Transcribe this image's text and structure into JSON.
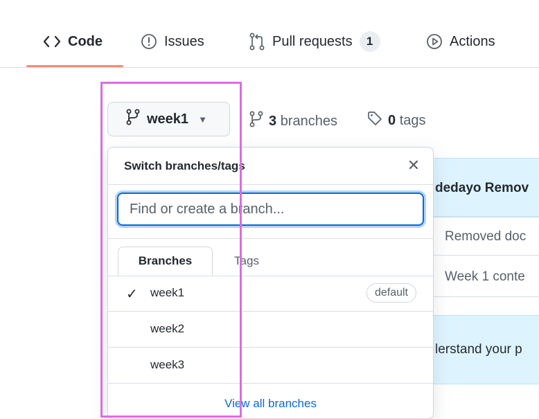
{
  "nav": {
    "tabs": [
      {
        "label": "Code",
        "icon": "code-icon",
        "active": true
      },
      {
        "label": "Issues",
        "icon": "issue-opened-icon"
      },
      {
        "label": "Pull requests",
        "icon": "git-pull-request-icon",
        "count": "1"
      },
      {
        "label": "Actions",
        "icon": "play-icon"
      }
    ]
  },
  "branch_selector": {
    "current": "week1",
    "branches_count": "3",
    "branches_label": "branches",
    "tags_count": "0",
    "tags_label": "tags"
  },
  "dropdown": {
    "title": "Switch branches/tags",
    "filter_placeholder": "Find or create a branch...",
    "tabs": [
      "Branches",
      "Tags"
    ],
    "items": [
      {
        "name": "week1",
        "selected": true,
        "badge": "default"
      },
      {
        "name": "week2"
      },
      {
        "name": "week3"
      }
    ],
    "footer_link": "View all branches"
  },
  "background": {
    "commit_text": "dedayo Remov",
    "rows": [
      "Removed doc",
      "Week 1 conte"
    ],
    "note": "lerstand your p"
  },
  "colors": {
    "accent_blue": "#0969da",
    "tab_underline": "#fd8c73",
    "highlight": "#d76fe0"
  }
}
